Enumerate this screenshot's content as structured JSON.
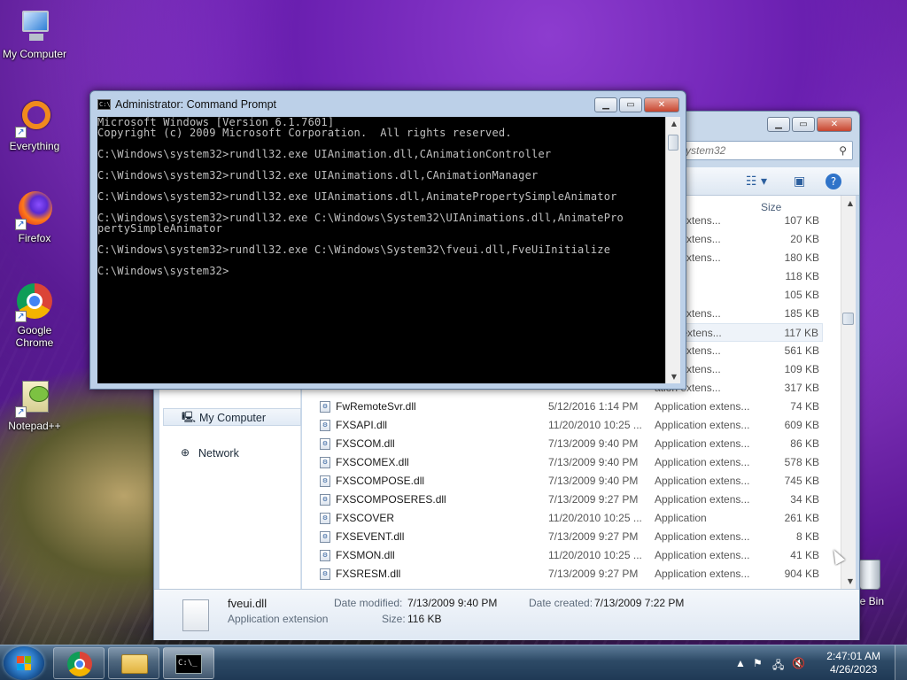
{
  "desktop": {
    "icons": [
      {
        "label": "My Computer",
        "icon": "computer-icon"
      },
      {
        "label": "Everything",
        "icon": "everything-icon"
      },
      {
        "label": "Firefox",
        "icon": "firefox-icon"
      },
      {
        "label": "Google Chrome",
        "icon": "chrome-icon"
      },
      {
        "label": "Notepad++",
        "icon": "notepadpp-icon"
      }
    ],
    "recycle_label": "cle Bin"
  },
  "cmd": {
    "title": "Administrator: Command Prompt",
    "lines": [
      "Microsoft Windows [Version 6.1.7601]",
      "Copyright (c) 2009 Microsoft Corporation.  All rights reserved.",
      "",
      "C:\\Windows\\system32>rundll32.exe UIAnimation.dll,CAnimationController",
      "",
      "C:\\Windows\\system32>rundll32.exe UIAnimations.dll,CAnimationManager",
      "",
      "C:\\Windows\\system32>rundll32.exe UIAnimations.dll,AnimatePropertySimpleAnimator",
      "",
      "C:\\Windows\\system32>rundll32.exe C:\\Windows\\System32\\UIAnimations.dll,AnimatePro",
      "pertySimpleAnimator",
      "",
      "C:\\Windows\\system32>rundll32.exe C:\\Windows\\System32\\fveui.dll,FveUiInitialize",
      "",
      "C:\\Windows\\system32>"
    ]
  },
  "explorer": {
    "search_text": "ystem32",
    "size_header": "Size",
    "nav": [
      {
        "label": "My Computer",
        "selected": true
      },
      {
        "label": "Network",
        "selected": false
      }
    ],
    "partial_rows": [
      {
        "type": "ation extens...",
        "size": "107 KB"
      },
      {
        "type": "ation extens...",
        "size": "20 KB"
      },
      {
        "type": "ation extens...",
        "size": "180 KB"
      },
      {
        "type": "ation",
        "size": "118 KB"
      },
      {
        "type": "ation",
        "size": "105 KB"
      },
      {
        "type": "ation extens...",
        "size": "185 KB"
      },
      {
        "type": "ation extens...",
        "size": "117 KB"
      },
      {
        "type": "ation extens...",
        "size": "561 KB"
      },
      {
        "type": "ation extens...",
        "size": "109 KB"
      },
      {
        "type": "ation extens...",
        "size": "317 KB"
      }
    ],
    "rows": [
      {
        "name": "FwRemoteSvr.dll",
        "date": "5/12/2016 1:14 PM",
        "type": "Application extens...",
        "size": "74 KB"
      },
      {
        "name": "FXSAPI.dll",
        "date": "11/20/2010 10:25 ...",
        "type": "Application extens...",
        "size": "609 KB"
      },
      {
        "name": "FXSCOM.dll",
        "date": "7/13/2009 9:40 PM",
        "type": "Application extens...",
        "size": "86 KB"
      },
      {
        "name": "FXSCOMEX.dll",
        "date": "7/13/2009 9:40 PM",
        "type": "Application extens...",
        "size": "578 KB"
      },
      {
        "name": "FXSCOMPOSE.dll",
        "date": "7/13/2009 9:40 PM",
        "type": "Application extens...",
        "size": "745 KB"
      },
      {
        "name": "FXSCOMPOSERES.dll",
        "date": "7/13/2009 9:27 PM",
        "type": "Application extens...",
        "size": "34 KB"
      },
      {
        "name": "FXSCOVER",
        "date": "11/20/2010 10:25 ...",
        "type": "Application",
        "size": "261 KB"
      },
      {
        "name": "FXSEVENT.dll",
        "date": "7/13/2009 9:27 PM",
        "type": "Application extens...",
        "size": "8 KB"
      },
      {
        "name": "FXSMON.dll",
        "date": "11/20/2010 10:25 ...",
        "type": "Application extens...",
        "size": "41 KB"
      },
      {
        "name": "FXSRESM.dll",
        "date": "7/13/2009 9:27 PM",
        "type": "Application extens...",
        "size": "904 KB"
      }
    ],
    "details": {
      "filename": "fveui.dll",
      "filetype": "Application extension",
      "modified_label": "Date modified:",
      "modified_value": "7/13/2009 9:40 PM",
      "created_label": "Date created:",
      "created_value": "7/13/2009 7:22 PM",
      "size_label": "Size:",
      "size_value": "116 KB"
    }
  },
  "taskbar": {
    "time": "2:47:01 AM",
    "date": "4/26/2023"
  }
}
